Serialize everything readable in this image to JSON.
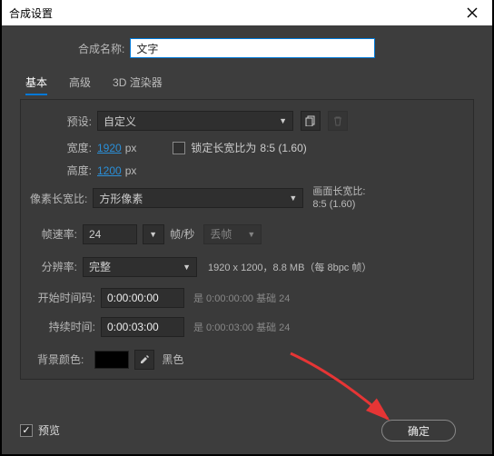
{
  "title": "合成设置",
  "name_label": "合成名称:",
  "name_value": "文字",
  "tabs": {
    "basic": "基本",
    "advanced": "高级",
    "renderer": "3D 渲染器"
  },
  "preset": {
    "label": "预设:",
    "value": "自定义"
  },
  "width": {
    "label": "宽度:",
    "value": "1920",
    "unit": "px"
  },
  "height": {
    "label": "高度:",
    "value": "1200",
    "unit": "px"
  },
  "lock": {
    "label": "锁定长宽比为",
    "ratio": "8:5 (1.60)"
  },
  "par": {
    "label": "像素长宽比:",
    "value": "方形像素",
    "right_label": "画面长宽比:",
    "right_value": "8:5 (1.60)"
  },
  "fps": {
    "label": "帧速率:",
    "value": "24",
    "unit": "帧/秒",
    "drop": "丢帧"
  },
  "res": {
    "label": "分辨率:",
    "value": "完整",
    "info": "1920 x 1200，8.8 MB（每 8bpc 帧）"
  },
  "start": {
    "label": "开始时间码:",
    "value": "0:00:00:00",
    "info": "是 0:00:00:00  基础 24"
  },
  "dur": {
    "label": "持续时间:",
    "value": "0:00:03:00",
    "info": "是 0:00:03:00  基础 24"
  },
  "bg": {
    "label": "背景颜色:",
    "name": "黑色",
    "hex": "#000000"
  },
  "preview_label": "预览",
  "ok_label": "确定"
}
